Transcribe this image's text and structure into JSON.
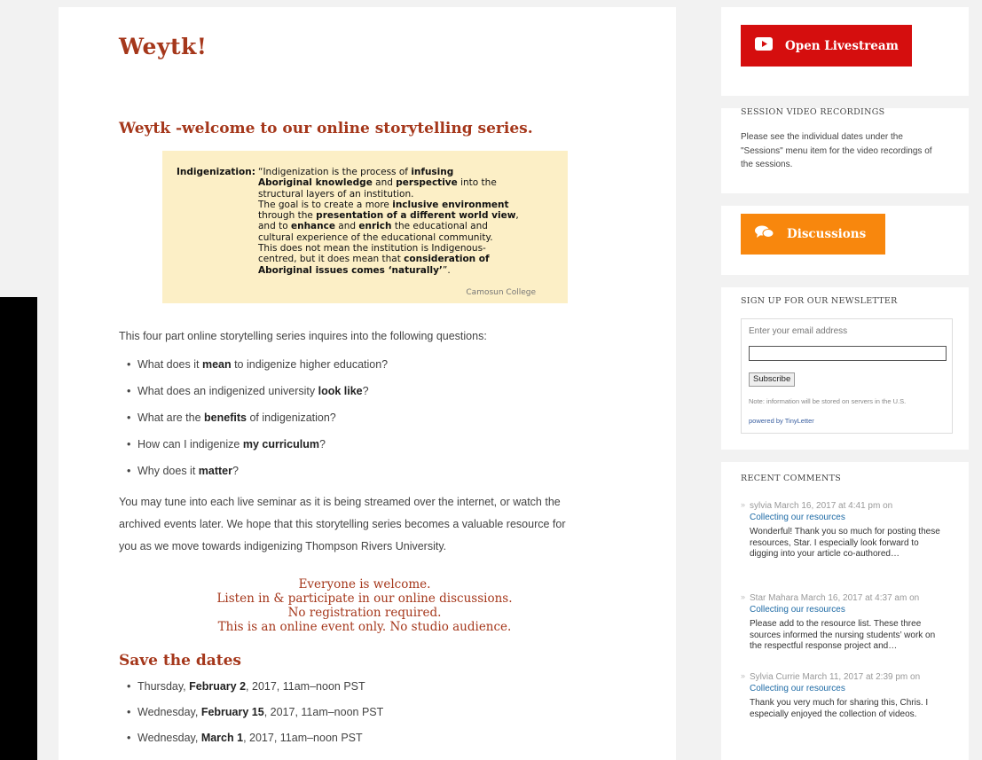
{
  "main": {
    "title": "Weytk!",
    "subtitle": "Weytk -welcome to our online storytelling series.",
    "quote": {
      "label": "Indigenization:",
      "lines": [
        [
          {
            "t": "“Indigenization is the process of ",
            "b": false
          },
          {
            "t": "infusing",
            "b": true
          }
        ],
        [
          {
            "t": "Aboriginal knowledge",
            "b": true
          },
          {
            "t": " and ",
            "b": false
          },
          {
            "t": "perspective",
            "b": true
          },
          {
            "t": " into the",
            "b": false
          }
        ],
        [
          {
            "t": "structural layers of an institution.",
            "b": false
          }
        ],
        [
          {
            "t": "The goal is to create a more ",
            "b": false
          },
          {
            "t": "inclusive environment",
            "b": true
          }
        ],
        [
          {
            "t": "through the ",
            "b": false
          },
          {
            "t": "presentation of a different world view",
            "b": true
          },
          {
            "t": ",",
            "b": false
          }
        ],
        [
          {
            "t": "and to ",
            "b": false
          },
          {
            "t": "enhance",
            "b": true
          },
          {
            "t": " and ",
            "b": false
          },
          {
            "t": "enrich",
            "b": true
          },
          {
            "t": " the educational and",
            "b": false
          }
        ],
        [
          {
            "t": "cultural experience of the educational community.",
            "b": false
          }
        ],
        [
          {
            "t": "This does not mean the institution is Indigenous-",
            "b": false
          }
        ],
        [
          {
            "t": "centred, but it does mean that ",
            "b": false
          },
          {
            "t": "consideration of",
            "b": true
          }
        ],
        [
          {
            "t": "Aboriginal issues comes ‘naturally’",
            "b": true
          },
          {
            "t": "”.",
            "b": false
          }
        ]
      ],
      "source": "Camosun College"
    },
    "intro": "This four part online storytelling series inquires into the following questions:",
    "questions": [
      [
        {
          "t": "What does it ",
          "b": false
        },
        {
          "t": "mean",
          "b": true
        },
        {
          "t": " to indigenize higher education?",
          "b": false
        }
      ],
      [
        {
          "t": "What does an indigenized university ",
          "b": false
        },
        {
          "t": "look like",
          "b": true
        },
        {
          "t": "?",
          "b": false
        }
      ],
      [
        {
          "t": "What are the ",
          "b": false
        },
        {
          "t": "benefits",
          "b": true
        },
        {
          "t": " of indigenization?",
          "b": false
        }
      ],
      [
        {
          "t": "How can I indigenize ",
          "b": false
        },
        {
          "t": "my curriculum",
          "b": true
        },
        {
          "t": "?",
          "b": false
        }
      ],
      [
        {
          "t": "Why does it ",
          "b": false
        },
        {
          "t": "matter",
          "b": true
        },
        {
          "t": "?",
          "b": false
        }
      ]
    ],
    "paragraph_lines": [
      "You may tune into each live seminar as it is being streamed over the internet, or watch the",
      "archived events later. We hope that this storytelling series becomes a valuable resource for",
      "you as we move towards indigenizing Thompson Rivers University."
    ],
    "welcome_lines": [
      "Everyone is welcome.",
      "Listen in & participate in our online discussions.",
      "No registration required.",
      "This is an online event only. No studio audience."
    ],
    "dates_heading": "Save the dates",
    "dates": [
      [
        {
          "t": "Thursday, ",
          "b": false
        },
        {
          "t": "February 2",
          "b": true
        },
        {
          "t": ", 2017, 11am–noon PST",
          "b": false
        }
      ],
      [
        {
          "t": "Wednesday, ",
          "b": false
        },
        {
          "t": "February 15",
          "b": true
        },
        {
          "t": ", 2017, 11am–noon PST",
          "b": false
        }
      ],
      [
        {
          "t": "Wednesday, ",
          "b": false
        },
        {
          "t": "March 1",
          "b": true
        },
        {
          "t": ", 2017, 11am–noon PST",
          "b": false
        }
      ]
    ]
  },
  "sidebar": {
    "livestream_label": "Open Livestream",
    "recordings_title": "SESSION VIDEO RECORDINGS",
    "recordings_text": "Please see the individual dates under the \"Sessions\" menu item for the video recordings of the sessions.",
    "discussions_label": "Discussions",
    "newsletter_title": "SIGN UP FOR OUR NEWSLETTER",
    "newsletter_label": "Enter your email address",
    "newsletter_input_value": "",
    "subscribe_label": "Subscribe",
    "newsletter_note": "Note: information will be stored on servers in the U.S.",
    "powered_by": "powered by TinyLetter",
    "comments_title": "RECENT COMMENTS",
    "comments": [
      {
        "head": "sylvia March 16, 2017 at 4:41 pm on",
        "link": "Collecting our resources",
        "body": "Wonderful! Thank you so much for posting these resources, Star. I especially look forward to digging into your article co-authored…"
      },
      {
        "head": "Star Mahara March 16, 2017 at 4:37 am on",
        "link": "Collecting our resources",
        "body": "Please add to the resource list. These three sources informed the nursing students’ work on the respectful response project and…"
      },
      {
        "head": "Sylvia Currie March 11, 2017 at 2:39 pm on",
        "link": "Collecting our resources",
        "body": "Thank you very much for sharing this, Chris. I especially enjoyed the collection of videos."
      }
    ]
  },
  "colors": {
    "accent": "#a5371b",
    "livestream_button": "#d50e0e",
    "discussions_button": "#f8870d",
    "quote_background": "#fcefc6",
    "link": "#1d6aa5"
  },
  "icons": {
    "livestream": "youtube-play-icon",
    "discussions": "speech-bubbles-icon"
  }
}
